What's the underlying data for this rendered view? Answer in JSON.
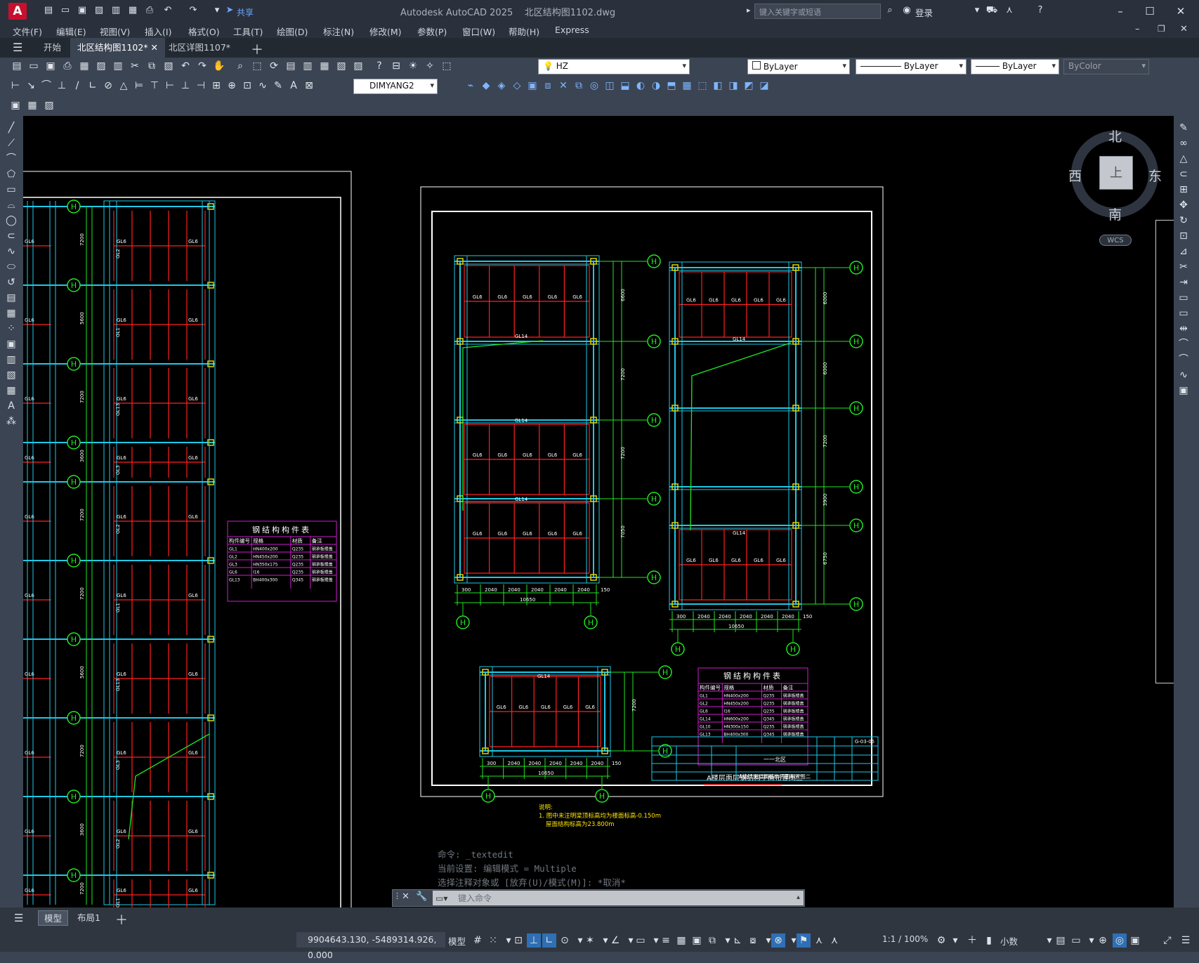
{
  "app": {
    "title": "Autodesk AutoCAD 2025",
    "document": "北区结构图1102.dwg",
    "logo": "A",
    "share": "共享",
    "search_placeholder": "键入关键字或短语",
    "login": "登录"
  },
  "menus": [
    "文件(F)",
    "编辑(E)",
    "视图(V)",
    "插入(I)",
    "格式(O)",
    "工具(T)",
    "绘图(D)",
    "标注(N)",
    "修改(M)",
    "参数(P)",
    "窗口(W)",
    "帮助(H)",
    "Express"
  ],
  "doc_tabs": [
    {
      "label": "开始",
      "active": false
    },
    {
      "label": "北区结构图1102*",
      "active": true
    },
    {
      "label": "北区详图1107*",
      "active": false
    }
  ],
  "ribbon": {
    "layer": "HZ",
    "color": "ByLayer",
    "linetype": "ByLayer",
    "lineweight": "ByLayer",
    "plotstyle": "ByColor",
    "dimstyle": "DIMYANG2"
  },
  "viewcube": {
    "north": "北",
    "south": "南",
    "east": "东",
    "west": "西",
    "wcs": "WCS",
    "face": "上"
  },
  "command": {
    "history": [
      "命令: _textedit",
      "当前设置: 编辑模式 = Multiple",
      "选择注释对象或 [放弃(U)/模式(M)]: *取消*"
    ],
    "placeholder": "键入命令"
  },
  "layout_tabs": [
    {
      "label": "模型",
      "active": true
    },
    {
      "label": "布局1",
      "active": false
    }
  ],
  "status": {
    "coords": "9904643.130, -5489314.926, 0.000",
    "model": "模型",
    "scale": "1:1 / 100%",
    "units": "小数"
  },
  "drawing": {
    "table_title": "钢结构构件表",
    "table_headers": [
      "构件编号",
      "规格",
      "材质",
      "备注"
    ],
    "table_rows_left": [
      [
        "GL1",
        "HN400x200",
        "Q235",
        "钢承板楼盖"
      ],
      [
        "GL2",
        "HN450x200",
        "Q235",
        "钢承板楼盖"
      ],
      [
        "GL3",
        "HN350x175",
        "Q235",
        "钢承板楼盖"
      ],
      [
        "GL6",
        "I16",
        "Q235",
        "钢承板楼盖"
      ],
      [
        "GL13",
        "BH400x300",
        "Q345",
        "钢承板楼盖"
      ]
    ],
    "table_rows_right": [
      [
        "GL1",
        "HN400x200",
        "Q235",
        "钢承板楼盖"
      ],
      [
        "GL2",
        "HN450x200",
        "Q235",
        "钢承板楼盖"
      ],
      [
        "GL6",
        "I16",
        "Q235",
        "钢承板楼盖"
      ],
      [
        "GL14",
        "HN600x200",
        "Q345",
        "钢承板楼盖"
      ],
      [
        "GL10",
        "HN300x150",
        "Q235",
        "钢承板楼盖"
      ],
      [
        "GL13",
        "BH400x300",
        "Q345",
        "钢承板楼盖"
      ]
    ],
    "sheet_title": "A楼层面层钢结构平面布置图二",
    "note_head": "说明:",
    "note_line1": "1. 图中未注明梁顶标高均为楼面标高-0.150m",
    "note_line2": "屋面结构标高为23.800m",
    "drawing_no": "G-03-05",
    "titleblock_title": "A楼层面层钢结构平面布置图二",
    "project": "一一北区",
    "beam_label": "GL6",
    "dims": [
      "300",
      "2040",
      "2040",
      "2040",
      "2040",
      "2040",
      "150"
    ],
    "dim_total": "10650",
    "vdims_a": [
      "6600",
      "7200",
      "7200",
      "7050"
    ],
    "vdims_b": [
      "6000",
      "6000",
      "7200",
      "3900",
      "6750"
    ],
    "axis_label": "H",
    "left_gl_labels": [
      "GL2",
      "GL1",
      "GL13",
      "GL3"
    ],
    "left_vdims": [
      "7200",
      "5600",
      "7200",
      "3600",
      "7200"
    ],
    "sheet_note": "GL14"
  }
}
